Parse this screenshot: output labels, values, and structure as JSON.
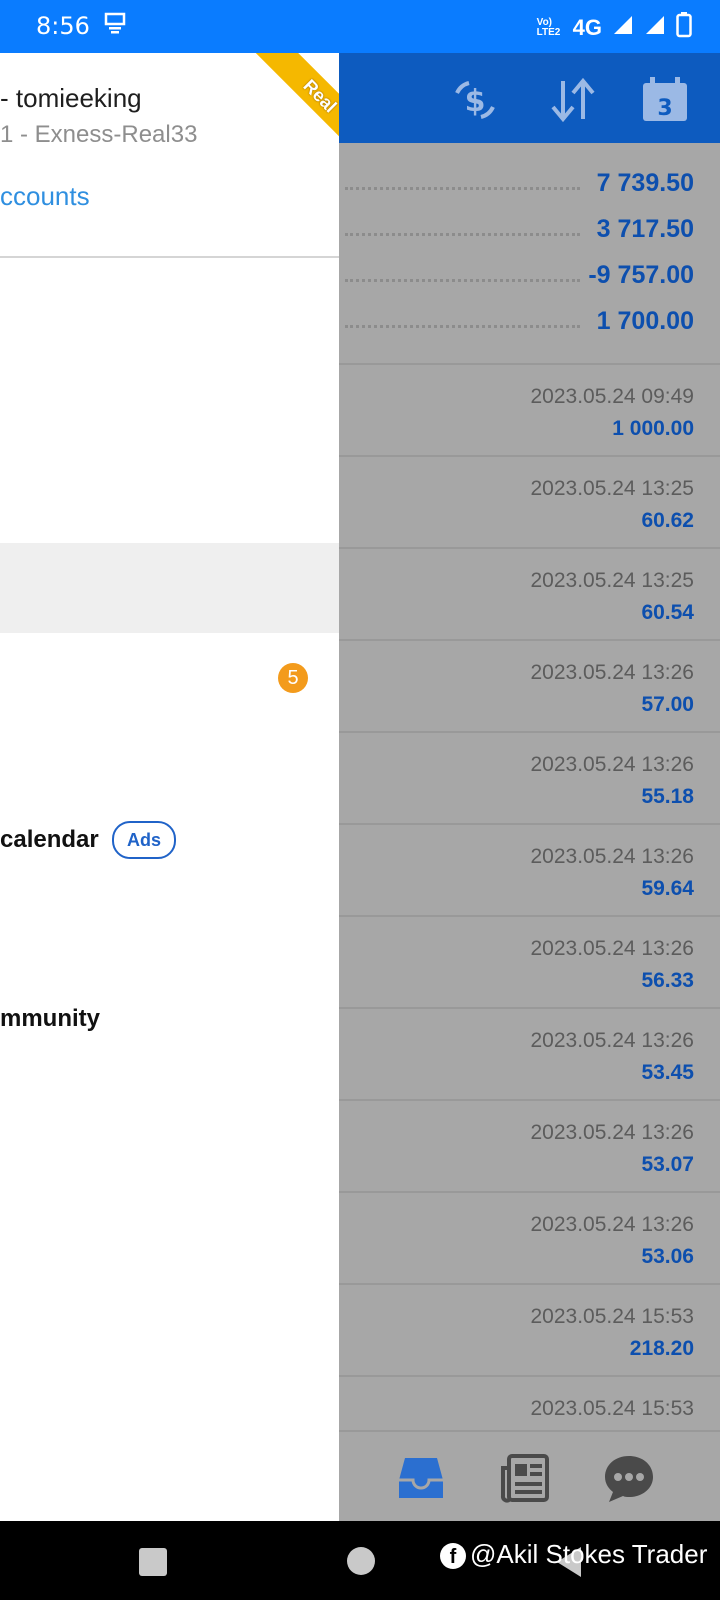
{
  "status_bar": {
    "time": "8:56",
    "network": "4G",
    "volte": "Vo) LTE2"
  },
  "drawer": {
    "account_name": "- tomieeking",
    "account_server": "1 - Exness-Real33",
    "accounts_link": "ccounts",
    "ribbon": "Real",
    "badge_count": "5",
    "calendar_label": "calendar",
    "ads_tag": "Ads",
    "community_label": "mmunity"
  },
  "main": {
    "balances": [
      "7 739.50",
      "3 717.50",
      "-9 757.00",
      "1 700.00"
    ],
    "deals": [
      {
        "date": "2023.05.24 09:49",
        "amount": "1 000.00"
      },
      {
        "date": "2023.05.24 13:25",
        "amount": "60.62"
      },
      {
        "date": "2023.05.24 13:25",
        "amount": "60.54"
      },
      {
        "date": "2023.05.24 13:26",
        "amount": "57.00"
      },
      {
        "date": "2023.05.24 13:26",
        "amount": "55.18"
      },
      {
        "date": "2023.05.24 13:26",
        "amount": "59.64"
      },
      {
        "date": "2023.05.24 13:26",
        "amount": "56.33"
      },
      {
        "date": "2023.05.24 13:26",
        "amount": "53.45"
      },
      {
        "date": "2023.05.24 13:26",
        "amount": "53.07"
      },
      {
        "date": "2023.05.24 13:26",
        "amount": "53.06"
      },
      {
        "date": "2023.05.24 15:53",
        "amount": "218.20"
      },
      {
        "date": "2023.05.24 15:53",
        "amount": ""
      }
    ],
    "calendar_icon_day": "3"
  },
  "watermark": "@Akil Stokes Trader",
  "colors": {
    "status_bar": "#0a7cff",
    "app_bar": "#0d5bbf",
    "value_blue": "#0d4fae",
    "link_blue": "#2f8fe0",
    "badge_orange": "#f39b1c",
    "ribbon_yellow": "#f5b800",
    "overlay_gray": "#a7a7a7"
  }
}
